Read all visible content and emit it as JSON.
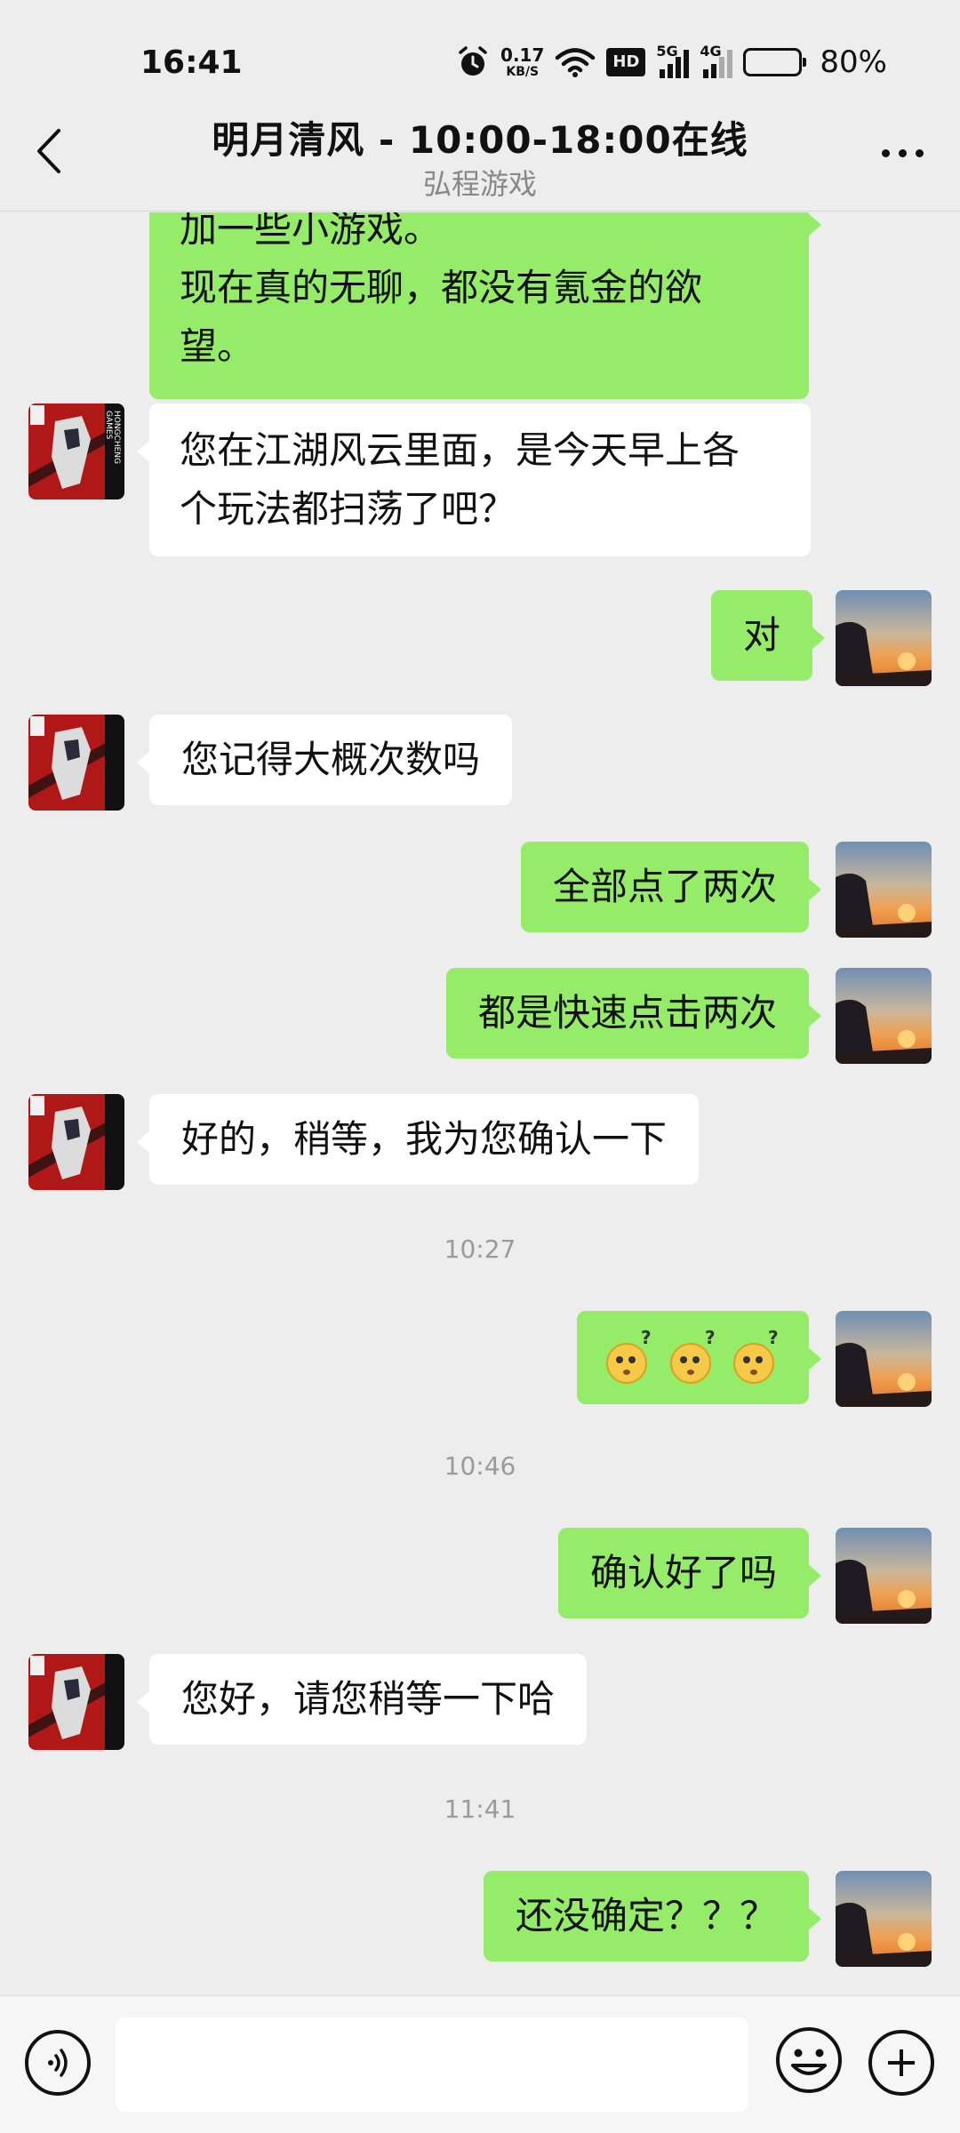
{
  "status_bar": {
    "time": "16:41",
    "net_speed_value": "0.17",
    "net_speed_unit": "KB/S",
    "hd_label": "HD",
    "signal1_label": "5G",
    "signal2_label": "4G",
    "battery_percent": "80%",
    "battery_level": 0.8,
    "icons": [
      "alarm-icon",
      "wifi-icon",
      "hd-icon",
      "signal-5g-icon",
      "signal-4g-icon",
      "battery-icon"
    ]
  },
  "header": {
    "title": "明月清风 - 10:00-18:00在线",
    "subtitle": "弘程游戏"
  },
  "messages": [
    {
      "type": "text",
      "direction": "out",
      "lines": [
        "加一些小游戏。",
        "现在真的无聊，都没有氪金的欲",
        "望。"
      ]
    },
    {
      "type": "text",
      "direction": "in",
      "lines": [
        "您在江湖风云里面，是今天早上各",
        "个玩法都扫荡了吧？"
      ]
    },
    {
      "type": "text",
      "direction": "out",
      "text": "对"
    },
    {
      "type": "text",
      "direction": "in",
      "text": "您记得大概次数吗"
    },
    {
      "type": "text",
      "direction": "out",
      "text": "全部点了两次"
    },
    {
      "type": "text",
      "direction": "out",
      "text": "都是快速点击两次"
    },
    {
      "type": "text",
      "direction": "in",
      "text": "好的，稍等，我为您确认一下"
    },
    {
      "type": "time",
      "text": "10:27"
    },
    {
      "type": "emoji",
      "direction": "out",
      "emoji": "confused-emoji",
      "count": 3
    },
    {
      "type": "time",
      "text": "10:46"
    },
    {
      "type": "text",
      "direction": "out",
      "text": "确认好了吗"
    },
    {
      "type": "text",
      "direction": "in",
      "text": "您好，请您稍等一下哈"
    },
    {
      "type": "time",
      "text": "11:41"
    },
    {
      "type": "text",
      "direction": "out",
      "text": "还没确定？？？"
    }
  ],
  "avatar_in_logo": {
    "line1": "HONGCHENG",
    "line2": "GAMES",
    "seal": "弘程游戏"
  },
  "input_bar": {
    "value": "",
    "placeholder": ""
  },
  "colors": {
    "background": "#ededed",
    "bubble_out": "#95ec69",
    "bubble_in": "#ffffff",
    "timestamp": "#9a9a9a",
    "subtitle": "#888888"
  }
}
